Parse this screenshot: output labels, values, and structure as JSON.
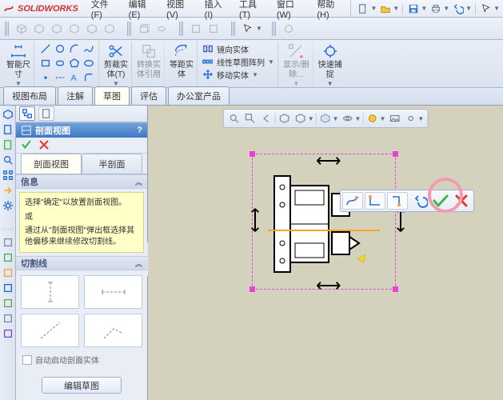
{
  "brand": "SOLIDWORKS",
  "menus": [
    "文件(F)",
    "编辑(E)",
    "视图(V)",
    "插入(I)",
    "工具(T)",
    "窗口(W)",
    "帮助(H)"
  ],
  "ribbon": {
    "group0": {
      "label1": "智能尺",
      "label2": "寸"
    },
    "group2": {
      "top": "剪裁实",
      "mid": "体(T)"
    },
    "group3": {
      "top": "转换实",
      "mid": "体引用"
    },
    "group4": {
      "top": "等距实",
      "mid": "体"
    },
    "group5_rows": [
      "镜向实体",
      "线性草图阵列",
      "移动实体"
    ],
    "group6": {
      "top": "显示/删",
      "mid": "除..."
    },
    "group7": {
      "top": "快速捕",
      "mid": "捉"
    }
  },
  "doctabs": [
    "视图布局",
    "注解",
    "草图",
    "评估",
    "办公室产品"
  ],
  "doctab_active": 2,
  "pm": {
    "title": "剖面视图",
    "question": "?",
    "subtabs": [
      "剖面视图",
      "半剖面"
    ],
    "subtab_active": 0,
    "section_info": "信息",
    "note_line1": "选择\"确定\"以放置剖面视图。",
    "note_line2": "或",
    "note_line3": "通过从\"剖面视图\"弹出框选择其他偏移来继续修改切割线。",
    "section_cut": "切割线",
    "chk_auto": "自动启动剖面实体",
    "edit_sketch": "编辑草图"
  },
  "popup_ring_target": "confirm",
  "chart_data": null
}
